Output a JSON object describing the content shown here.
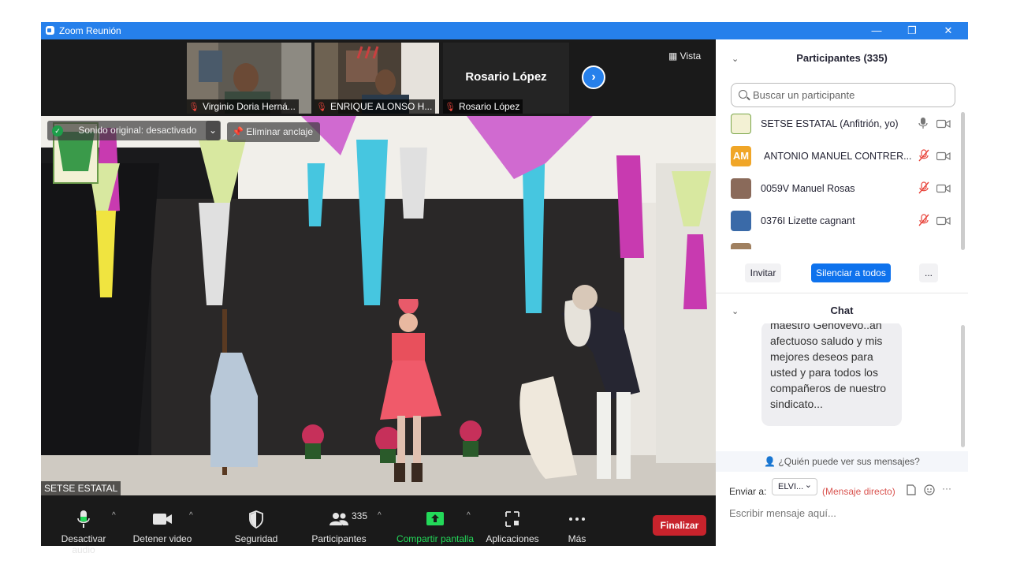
{
  "window": {
    "title": "Zoom Reunión",
    "min_symbol": "—",
    "restore_symbol": "❐",
    "close_symbol": "✕"
  },
  "thumbnails": [
    {
      "name": "Virginio Doria Herná..."
    },
    {
      "name": "ENRIQUE ALONSO H..."
    },
    {
      "name": "Rosario López"
    }
  ],
  "strip_featured_name": "Rosario López",
  "view_button": "Vista",
  "next_symbol": "›",
  "main_video": {
    "badge_text": "Sonido original: desactivado",
    "badge_caret": "⌄",
    "unpin_label": "Eliminar anclaje",
    "speaker_name": "SETSE ESTATAL"
  },
  "toolbar": {
    "mute": "Desactivar audio",
    "video": "Detener video",
    "security": "Seguridad",
    "participants": "Participantes",
    "participants_count": "335",
    "share": "Compartir pantalla",
    "apps": "Aplicaciones",
    "more": "Más",
    "end": "Finalizar",
    "caret": "^"
  },
  "participants_panel": {
    "header": "Participantes (335)",
    "search_placeholder": "Buscar un participante",
    "participants": [
      {
        "name": "SETSE ESTATAL (Anfitrión, yo)",
        "initials": "",
        "muted": false
      },
      {
        "name": "ANTONIO MANUEL CONTRER...",
        "initials": "AM",
        "muted": true
      },
      {
        "name": "0059V Manuel Rosas",
        "initials": "",
        "muted": true
      },
      {
        "name": "0376I Lizette cagnant",
        "initials": "",
        "muted": true
      }
    ],
    "invite": "Invitar",
    "mute_all": "Silenciar a todos",
    "more": "..."
  },
  "chat_panel": {
    "header": "Chat",
    "message_lines": [
      "maestro Genovevo..an",
      "afectuoso saludo y mis",
      "mejores deseos para",
      "usted y para todos los",
      "compañeros de nuestro",
      "sindicato..."
    ],
    "who_can_see": "¿Quién puede ver sus mensajes?",
    "send_to_label": "Enviar a:",
    "recipient": "ELVI...",
    "recipient_caret": "⌄",
    "direct_message": "(Mensaje directo)",
    "input_placeholder": "Escribir mensaje aquí...",
    "more_symbol": "···"
  },
  "colors": {
    "titlebar": "#2680eb",
    "accent": "#2680eb",
    "end_button": "#c8232c",
    "share_green": "#23d959",
    "muted_red": "#e8433a"
  }
}
